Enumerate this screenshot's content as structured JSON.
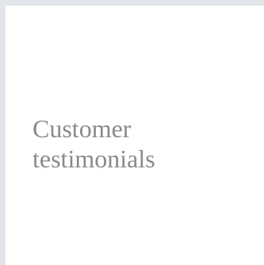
{
  "card": {
    "title": "Customer testimonials"
  },
  "colors": {
    "page_background": "#e2e6ea",
    "card_background": "#ffffff",
    "title_text": "#8a8a8a"
  }
}
